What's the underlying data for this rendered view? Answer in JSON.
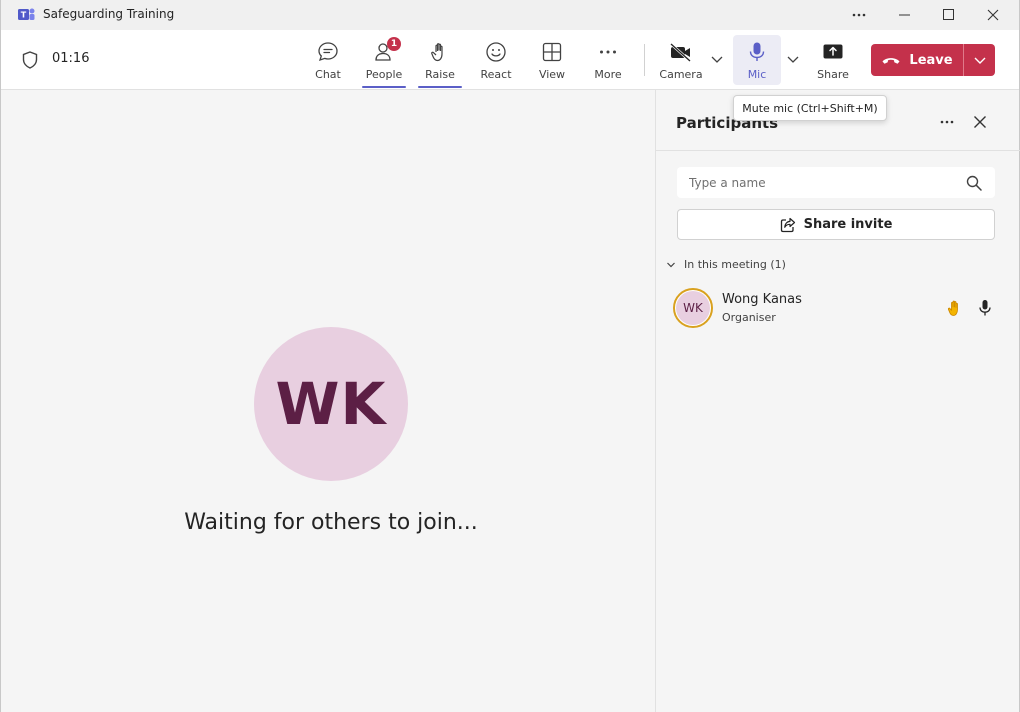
{
  "window": {
    "title": "Safeguarding Training"
  },
  "toolbar": {
    "timer": "01:16",
    "chat_label": "Chat",
    "people_label": "People",
    "people_badge": "1",
    "raise_label": "Raise",
    "react_label": "React",
    "view_label": "View",
    "more_label": "More",
    "camera_label": "Camera",
    "mic_label": "Mic",
    "share_label": "Share",
    "leave_label": "Leave"
  },
  "tooltip": {
    "text": "Mute mic (Ctrl+Shift+M)"
  },
  "stage": {
    "avatar_initials": "WK",
    "waiting_text": "Waiting for others to join..."
  },
  "panel": {
    "title": "Participants",
    "search_placeholder": "Type a name",
    "share_invite_label": "Share invite",
    "section_label": "In this meeting (1)",
    "participants": [
      {
        "initials": "WK",
        "name": "Wong Kanas",
        "role": "Organiser"
      }
    ]
  },
  "colors": {
    "accent": "#5b5fc7",
    "leave": "#c4314b",
    "avatar_bg": "#e8cfe0",
    "avatar_text": "#5c1f45",
    "hand": "#e8a317"
  }
}
